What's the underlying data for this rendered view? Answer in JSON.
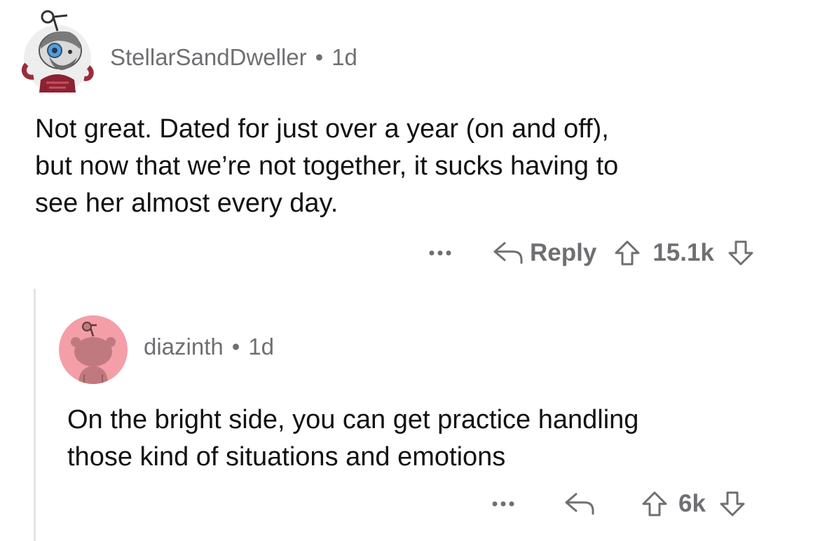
{
  "comment": {
    "username": "StellarSandDweller",
    "separator": "•",
    "age": "1d",
    "body": [
      "Not great. Dated for just over a year (on and off),",
      "but now that we’re not together, it sucks having to",
      "see her almost every day."
    ],
    "more_icon": "ellipsis-icon",
    "reply_label": "Reply",
    "score": "15.1k"
  },
  "reply": {
    "username": "diazinth",
    "separator": "•",
    "age": "1d",
    "body": [
      "On the bright side, you can get practice handling",
      "those kind of situations and emotions"
    ],
    "score": "6k"
  },
  "colors": {
    "meta_gray": "#6f6f73",
    "thread_line": "#e4e4e7",
    "reply_avatar_bg": "#f49ea8",
    "snoo_body": "#c07a7f"
  }
}
